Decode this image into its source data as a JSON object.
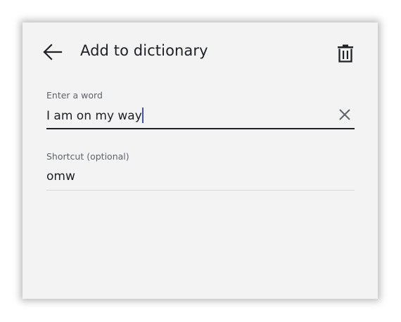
{
  "header": {
    "title": "Add to dictionary",
    "back_icon": "arrow-back-icon",
    "delete_icon": "trash-icon"
  },
  "word_field": {
    "label": "Enter a word",
    "value": "I am on my way",
    "clear_icon": "close-icon"
  },
  "shortcut_field": {
    "label": "Shortcut (optional)",
    "value": "omw"
  },
  "colors": {
    "panel_bg": "#f3f3f3",
    "text_primary": "#202124",
    "text_secondary": "#5f6368",
    "cursor": "#3f51b5"
  }
}
